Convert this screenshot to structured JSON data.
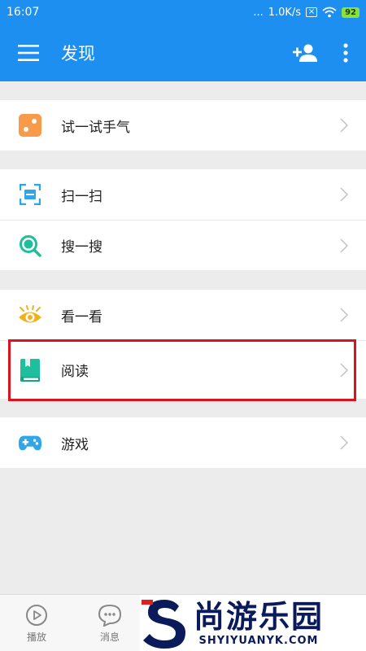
{
  "status_bar": {
    "time": "16:07",
    "dots": "...",
    "speed": "1.0K/s",
    "sim": "×",
    "battery": "92"
  },
  "app_bar": {
    "title": "发现"
  },
  "menu": {
    "groups": [
      {
        "items": [
          {
            "label": "试一试手气",
            "icon": "dice-icon"
          }
        ]
      },
      {
        "items": [
          {
            "label": "扫一扫",
            "icon": "scan-icon"
          },
          {
            "label": "搜一搜",
            "icon": "magnifier-icon"
          }
        ]
      },
      {
        "items": [
          {
            "label": "看一看",
            "icon": "eye-icon"
          },
          {
            "label": "阅读",
            "icon": "book-icon"
          }
        ]
      },
      {
        "items": [
          {
            "label": "游戏",
            "icon": "gamepad-icon"
          }
        ]
      }
    ]
  },
  "bottom_nav": {
    "tabs": [
      {
        "label": "播放",
        "icon": "play-icon"
      },
      {
        "label": "消息",
        "icon": "chat-icon"
      }
    ]
  },
  "watermark": {
    "cn": "尚游乐园",
    "en": "SHYIYUANYK.COM"
  },
  "colors": {
    "primary": "#1d8ff0",
    "highlight": "#d9141e",
    "dice": "#f79a4a",
    "teal": "#1fbf9e",
    "scan": "#2fa6e8",
    "eye": "#f0b21a"
  }
}
